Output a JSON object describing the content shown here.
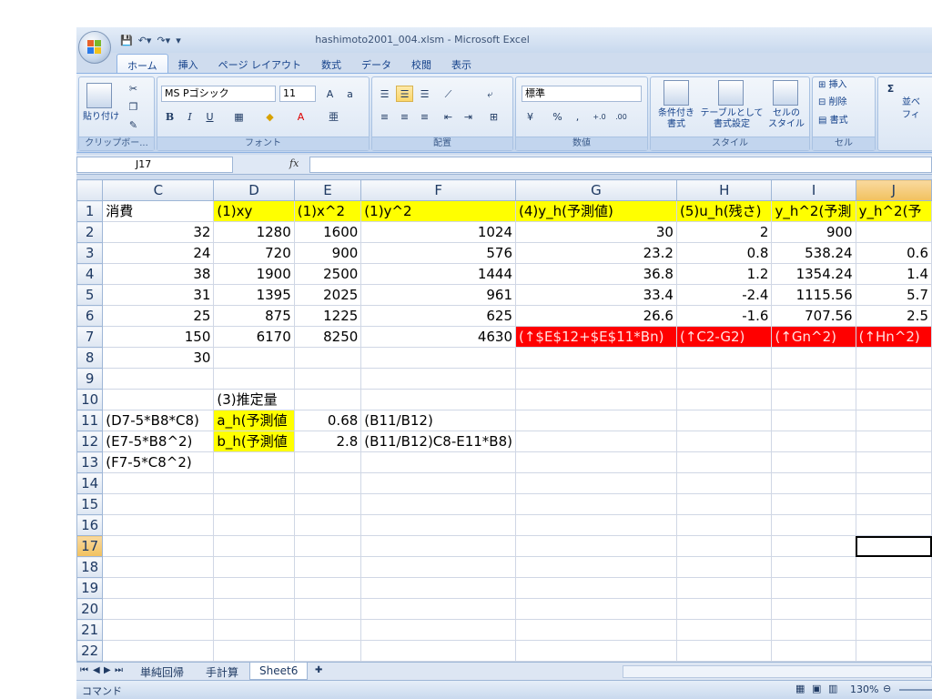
{
  "window": {
    "title": "hashimoto2001_004.xlsm - Microsoft Excel"
  },
  "ribbon_tabs": [
    "ホーム",
    "挿入",
    "ページ レイアウト",
    "数式",
    "データ",
    "校閲",
    "表示"
  ],
  "ribbon": {
    "clipboard": {
      "paste": "貼り付け",
      "label": "クリップボー..."
    },
    "font": {
      "name": "MS Pゴシック",
      "size": "11",
      "label": "フォント",
      "bold": "B",
      "italic": "I",
      "underline": "U"
    },
    "alignment": {
      "label": "配置"
    },
    "number": {
      "format": "標準",
      "percent": "%",
      "comma": ",",
      "label": "数値"
    },
    "styles": {
      "conditional": "条件付き\n書式",
      "table": "テーブルとして\n書式設定",
      "cell": "セルの\nスタイル",
      "label": "スタイル"
    },
    "cells": {
      "insert": "挿入",
      "delete": "削除",
      "format": "書式",
      "label": "セル"
    },
    "editing": {
      "sigma": "Σ",
      "sort": "並べ",
      "filter": "フィ"
    }
  },
  "formula_bar": {
    "name_box": "J17",
    "fx": "fx",
    "content": ""
  },
  "sheet": {
    "columns": [
      "C",
      "D",
      "E",
      "F",
      "G",
      "H",
      "I",
      "J"
    ],
    "selected_column": "J",
    "selected_row": "17",
    "rows": [
      {
        "n": "1",
        "cells": [
          "消費",
          "(1)xy",
          "(1)x^2",
          "(1)y^2",
          "(4)y_h(予測値)",
          "(5)u_h(残さ)",
          "y_h^2(予測",
          "y_h^2(予"
        ]
      },
      {
        "n": "2",
        "cells": [
          "32",
          "1280",
          "1600",
          "1024",
          "30",
          "2",
          "900",
          ""
        ]
      },
      {
        "n": "3",
        "cells": [
          "24",
          "720",
          "900",
          "576",
          "23.2",
          "0.8",
          "538.24",
          "0.6"
        ]
      },
      {
        "n": "4",
        "cells": [
          "38",
          "1900",
          "2500",
          "1444",
          "36.8",
          "1.2",
          "1354.24",
          "1.4"
        ]
      },
      {
        "n": "5",
        "cells": [
          "31",
          "1395",
          "2025",
          "961",
          "33.4",
          "-2.4",
          "1115.56",
          "5.7"
        ]
      },
      {
        "n": "6",
        "cells": [
          "25",
          "875",
          "1225",
          "625",
          "26.6",
          "-1.6",
          "707.56",
          "2.5"
        ]
      },
      {
        "n": "7",
        "cells": [
          "150",
          "6170",
          "8250",
          "4630",
          "(↑$E$12+$E$11*Bn)",
          "(↑C2-G2)",
          "(↑Gn^2)",
          "(↑Hn^2)"
        ]
      },
      {
        "n": "8",
        "cells": [
          "30",
          "",
          "",
          "",
          "",
          "",
          "",
          ""
        ]
      },
      {
        "n": "9",
        "cells": [
          "",
          "",
          "",
          "",
          "",
          "",
          "",
          ""
        ]
      },
      {
        "n": "10",
        "cells": [
          "",
          "(3)推定量",
          "",
          "",
          "",
          "",
          "",
          ""
        ]
      },
      {
        "n": "11",
        "cells": [
          "(D7-5*B8*C8)",
          "a_h(予測値",
          "0.68",
          "(B11/B12)",
          "",
          "",
          "",
          ""
        ]
      },
      {
        "n": "12",
        "cells": [
          "(E7-5*B8^2)",
          "b_h(予測値",
          "2.8",
          "(B11/B12)C8-E11*B8)",
          "",
          "",
          "",
          ""
        ]
      },
      {
        "n": "13",
        "cells": [
          "(F7-5*C8^2)",
          "",
          "",
          "",
          "",
          "",
          "",
          ""
        ]
      },
      {
        "n": "14",
        "cells": [
          "",
          "",
          "",
          "",
          "",
          "",
          "",
          ""
        ]
      },
      {
        "n": "15",
        "cells": [
          "",
          "",
          "",
          "",
          "",
          "",
          "",
          ""
        ]
      },
      {
        "n": "16",
        "cells": [
          "",
          "",
          "",
          "",
          "",
          "",
          "",
          ""
        ]
      },
      {
        "n": "17",
        "cells": [
          "",
          "",
          "",
          "",
          "",
          "",
          "",
          ""
        ]
      },
      {
        "n": "18",
        "cells": [
          "",
          "",
          "",
          "",
          "",
          "",
          "",
          ""
        ]
      },
      {
        "n": "19",
        "cells": [
          "",
          "",
          "",
          "",
          "",
          "",
          "",
          ""
        ]
      },
      {
        "n": "20",
        "cells": [
          "",
          "",
          "",
          "",
          "",
          "",
          "",
          ""
        ]
      },
      {
        "n": "21",
        "cells": [
          "",
          "",
          "",
          "",
          "",
          "",
          "",
          ""
        ]
      },
      {
        "n": "22",
        "cells": [
          "",
          "",
          "",
          "",
          "",
          "",
          "",
          ""
        ]
      }
    ]
  },
  "sheet_tabs": [
    "単純回帰",
    "手計算",
    "Sheet6"
  ],
  "active_sheet": "Sheet6",
  "status": {
    "mode": "コマンド",
    "zoom": "130%"
  },
  "colors": {
    "yellow": "#ffff00",
    "red": "#ff0000",
    "accent": "#15428b"
  }
}
